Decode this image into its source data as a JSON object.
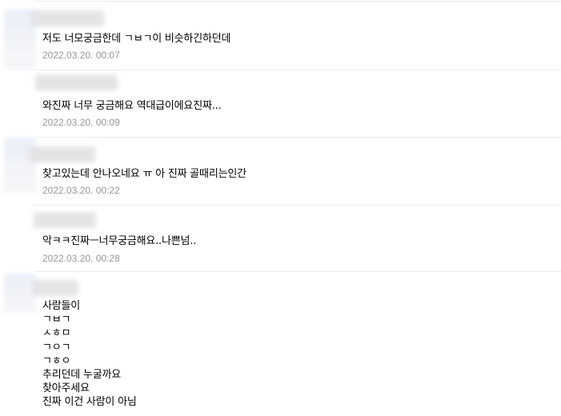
{
  "comments": [
    {
      "text": "저도 너모궁금한데 ㄱㅂㄱ이 비슷하긴하던데",
      "date": "2022.03.20. 00:07"
    },
    {
      "text": "와진짜 너무 궁금해요 역대급이에요진짜...",
      "date": "2022.03.20. 00:09"
    },
    {
      "text": "찾고있는데 안나오네요 ㅠ 아 진짜 골때리는인간",
      "date": "2022.03.20. 00:22"
    },
    {
      "text": "악ㅋㅋ진짜ㅡ너무궁금해요..나쁜넘..",
      "date": "2022.03.20. 00:28"
    }
  ],
  "last_comment": {
    "lines": [
      "사람들이",
      "ㄱㅂㄱ",
      "ㅅㅎㅁ",
      "ㄱㅇㄱ",
      "ㄱㅎㅇ",
      "추리던데 누굴까요",
      "찾아주세요",
      "진짜 이건 사람이 아님"
    ]
  }
}
